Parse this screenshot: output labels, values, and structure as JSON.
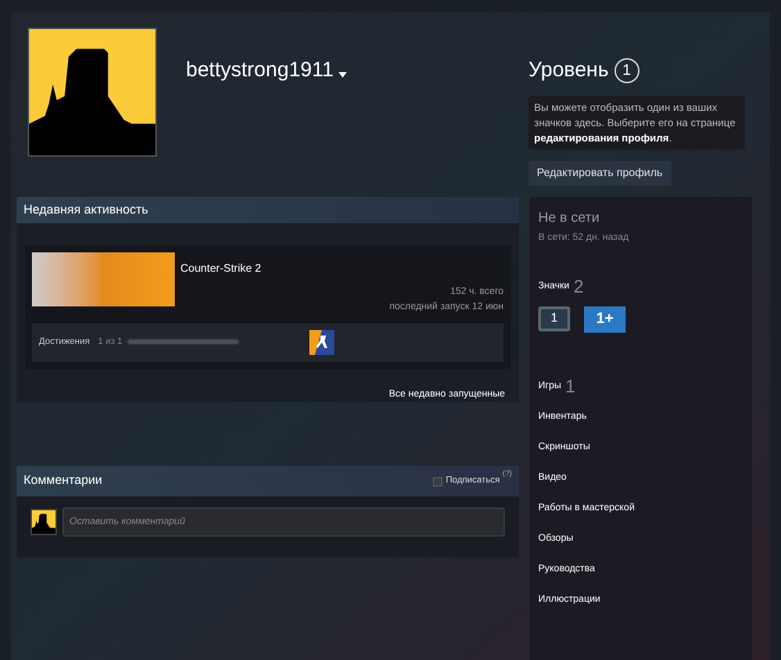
{
  "profile": {
    "username": "bettystrong1911",
    "level_label": "Уровень",
    "level": "1",
    "info_text": "Вы можете отобразить один из ваших значков здесь. Выберите его на странице **редактирования профиля**.",
    "edit_button": "Редактировать профиль"
  },
  "recent_activity": {
    "title": "Недавняя активность",
    "games": [
      {
        "name": "Counter-Strike 2",
        "hours": "152 ч. всего",
        "last_played": "последний запуск 12 июн",
        "achievements_label": "Достижения",
        "achievements_count": "1 из 1",
        "level": 1
      }
    ],
    "all_link": "Все недавно запущенные"
  },
  "comments": {
    "title": "Комментарии",
    "subscribe": {
      "label": "Подписаться",
      "checked": false
    },
    "help": "(?)",
    "placeholder": "Оставить комментарий"
  },
  "sidebar": {
    "status": "Не в сети",
    "last_online": "В сети: 52 дн. назад",
    "badges_label": "Значки",
    "badges_count": "2",
    "badges": [
      {
        "text": "1",
        "kind": "level"
      },
      {
        "text": "1+",
        "kind": "years"
      }
    ],
    "games_label": "Игры",
    "games_count": "1",
    "links": [
      "Инвентарь",
      "Скриншоты",
      "Видео",
      "Работы в мастерской",
      "Обзоры",
      "Руководства",
      "Иллюстрации"
    ]
  }
}
